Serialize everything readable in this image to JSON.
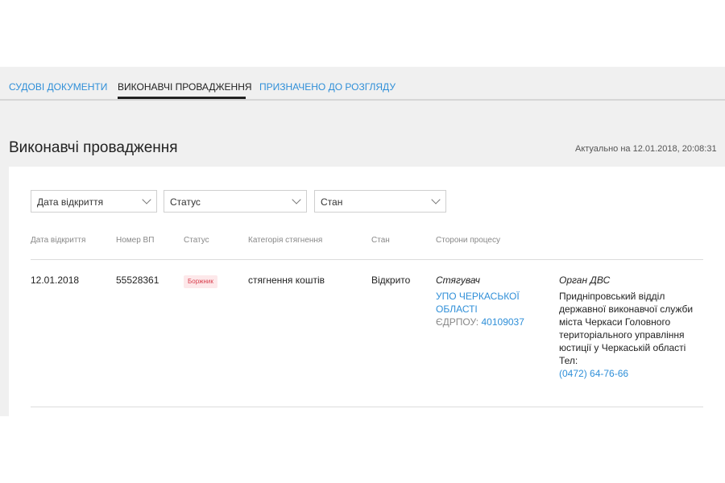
{
  "tabs": [
    {
      "label": "Судові документи",
      "active": false
    },
    {
      "label": "Виконавчі провадження",
      "active": true
    },
    {
      "label": "Призначено до розгляду",
      "active": false
    }
  ],
  "page": {
    "title": "Виконавчі провадження",
    "updated": "Актуально на 12.01.2018, 20:08:31"
  },
  "filters": [
    {
      "label": "Дата відкриття"
    },
    {
      "label": "Статус"
    },
    {
      "label": "Стан"
    }
  ],
  "table": {
    "headers": [
      "Дата відкриття",
      "Номер ВП",
      "Статус",
      "Категорія стягнення",
      "Стан",
      "Сторони процесу"
    ],
    "row": {
      "date": "12.01.2018",
      "number": "55528361",
      "status": "Боржник",
      "category": "стягнення коштів",
      "state": "Відкрито",
      "creditor": {
        "role": "Стягувач",
        "name_line1": "УПО ЧЕРКАСЬКОЇ",
        "name_line2": "ОБЛАСТІ",
        "edrpou_label": "ЄДРПОУ:",
        "edrpou": "40109037"
      },
      "authority": {
        "role": "Орган ДВС",
        "lines": [
          "Придніпровський відділ",
          "державної виконавчої служби",
          "міста Черкаси Головного",
          "територіального управління",
          "юстиції у Черкаській області"
        ],
        "phone_label": "Тел:",
        "phone": "(0472) 64-76-66"
      }
    }
  },
  "colors": {
    "link": "#2f8fd8",
    "badge_bg": "#fde8ea",
    "badge_text": "#d9414f"
  }
}
